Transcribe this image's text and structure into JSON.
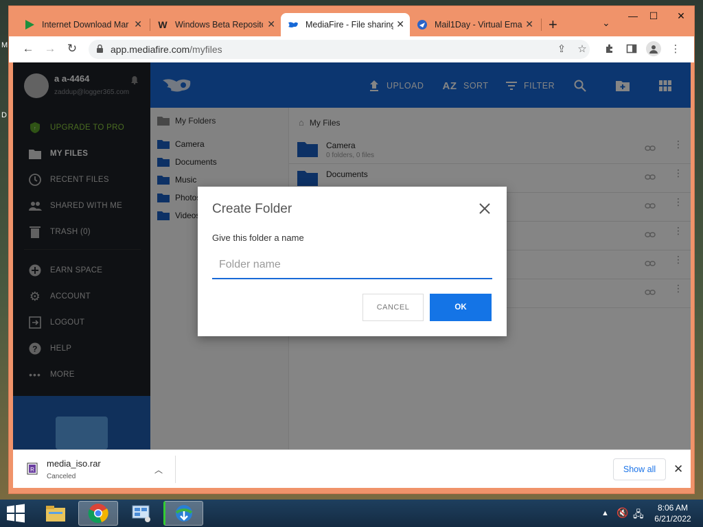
{
  "desktop": {
    "letters": [
      "M",
      "D"
    ]
  },
  "browser": {
    "tabs": [
      {
        "title": "Internet Download Mar",
        "active": false
      },
      {
        "title": "Windows Beta Reposito",
        "active": false
      },
      {
        "title": "MediaFire - File sharing",
        "active": true
      },
      {
        "title": "Mail1Day - Virtual Ema",
        "active": false
      }
    ],
    "url_host": "app.mediafire.com",
    "url_path": "/myfiles"
  },
  "sidebar": {
    "username": "a a-4464",
    "email": "zaddup@logger365.com",
    "items": [
      {
        "label": "UPGRADE TO PRO",
        "icon": "shield-icon"
      },
      {
        "label": "MY FILES",
        "icon": "folder-icon"
      },
      {
        "label": "RECENT FILES",
        "icon": "clock-icon"
      },
      {
        "label": "SHARED WITH ME",
        "icon": "people-icon"
      },
      {
        "label": "TRASH (0)",
        "icon": "trash-icon"
      },
      {
        "label": "EARN SPACE",
        "icon": "plus-circle-icon"
      },
      {
        "label": "ACCOUNT",
        "icon": "gear-icon"
      },
      {
        "label": "LOGOUT",
        "icon": "logout-icon"
      },
      {
        "label": "HELP",
        "icon": "help-icon"
      },
      {
        "label": "MORE",
        "icon": "dots-icon"
      }
    ]
  },
  "appbar": {
    "upload": "UPLOAD",
    "sort": "SORT",
    "filter": "FILTER"
  },
  "tree": {
    "header": "My Folders",
    "items": [
      "Camera",
      "Documents",
      "Music",
      "Photos",
      "Videos"
    ]
  },
  "files": {
    "breadcrumb": "My Files",
    "rows": [
      {
        "name": "Camera",
        "meta": "0 folders, 0 files"
      },
      {
        "name": "Documents",
        "meta": ""
      },
      {
        "name": "",
        "meta": ""
      },
      {
        "name": "",
        "meta": ""
      },
      {
        "name": "",
        "meta": ""
      },
      {
        "name": "",
        "meta": ""
      }
    ]
  },
  "dialog": {
    "title": "Create Folder",
    "subtitle": "Give this folder a name",
    "placeholder": "Folder name",
    "value": "",
    "cancel": "CANCEL",
    "ok": "OK"
  },
  "download": {
    "filename": "media_iso.rar",
    "status": "Canceled",
    "show_all": "Show all"
  },
  "taskbar": {
    "time": "8:06 AM",
    "date": "6/21/2022"
  },
  "colors": {
    "browser_frame": "#f0936a",
    "mediafire_blue": "#1769d7",
    "ok_button": "#1474e6",
    "upgrade_green": "#8fcf40"
  }
}
